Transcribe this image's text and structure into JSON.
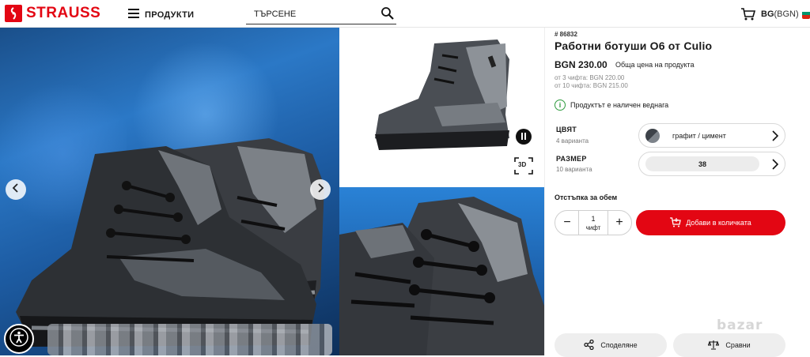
{
  "header": {
    "logo_text": "STRAUSS",
    "menu_label": "ПРОДУКТИ",
    "search_placeholder": "ТЪРСЕНЕ",
    "lang_code": "BG",
    "currency": "(BGN)",
    "brand_color": "#e30613"
  },
  "product": {
    "sku": "# 86832",
    "title": "Работни ботуши O6 от Culio",
    "price": "BGN 230.00",
    "price_note": "Обща цена на продукта",
    "tiers": [
      "от 3 чифта: BGN 220.00",
      "от 10 чифта: BGN 215.00"
    ],
    "stock_text": "Продуктът е наличен веднага",
    "color_label": "ЦВЯТ",
    "color_variants": "4 варианта",
    "color_value": "графит / цимент",
    "size_label": "РАЗМЕР",
    "size_variants": "10 варианта",
    "size_value": "38",
    "bulk_label": "Отстъпка за обем",
    "quantity": "1",
    "quantity_unit": "чифт",
    "add_to_cart": "Добави в количката",
    "share": "Споделяне",
    "compare": "Сравни",
    "threed_label": "3D"
  },
  "icons": [
    "menu-icon",
    "search-icon",
    "cart-icon",
    "flag-icon",
    "arrow-left-icon",
    "arrow-right-icon",
    "pause-icon",
    "3d-icon",
    "accessibility-icon",
    "info-icon",
    "chevron-right-icon",
    "cart-add-icon",
    "share-icon",
    "compare-icon"
  ],
  "watermark": "bazar"
}
